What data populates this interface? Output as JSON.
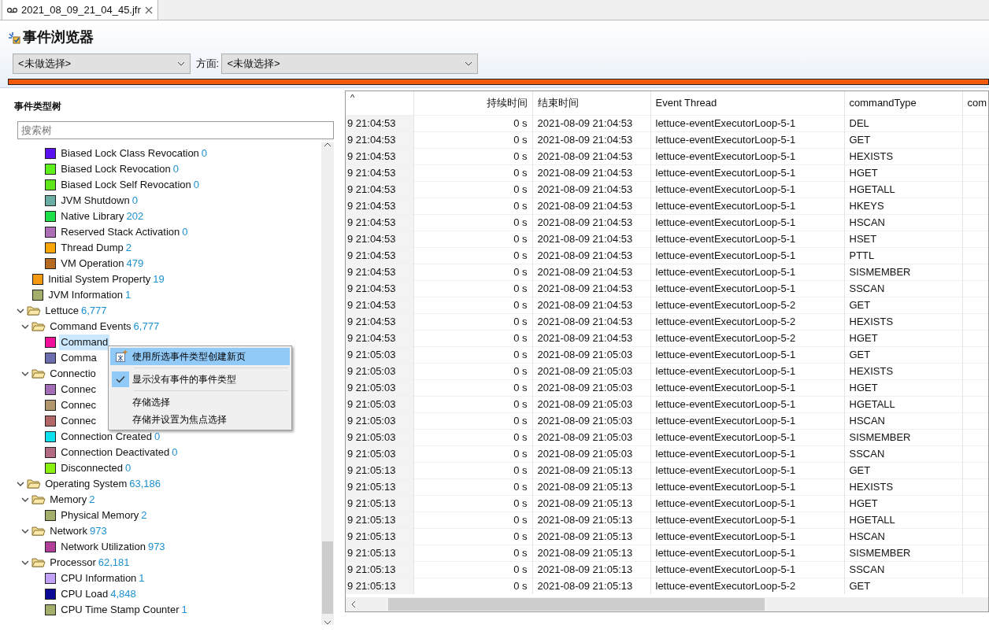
{
  "tab": {
    "title": "2021_08_09_21_04_45.jfr",
    "selected": true
  },
  "page": {
    "title": "事件浏览器",
    "progress": {
      "level": 1
    }
  },
  "filters": {
    "first": {
      "value": "<未做选择>"
    },
    "aspect_label": "方面:",
    "aspect": {
      "value": "<未做选择>"
    }
  },
  "tree": {
    "title": "事件类型树",
    "search": {
      "placeholder": "搜索树"
    },
    "items": [
      {
        "children": [
          {
            "children": [
              {
                "label": "Biased Lock Class Revocation",
                "count": "0",
                "color": "#5b10f0"
              },
              {
                "label": "Biased Lock Revocation",
                "count": "0",
                "color": "#5ef01a"
              },
              {
                "label": "Biased Lock Self Revocation",
                "count": "0",
                "color": "#5ee61a"
              },
              {
                "label": "JVM Shutdown",
                "count": "0",
                "color": "#6aaea6"
              },
              {
                "label": "Native Library",
                "count": "202",
                "color": "#1ee04a"
              },
              {
                "label": "Reserved Stack Activation",
                "count": "0",
                "color": "#ae6eb6"
              },
              {
                "label": "Thread Dump",
                "count": "2",
                "color": "#fca60a"
              },
              {
                "label": "VM Operation",
                "count": "479",
                "color": "#b66a22"
              }
            ]
          },
          {
            "label": "Initial System Property",
            "count": "19",
            "color": "#f49a12"
          },
          {
            "label": "JVM Information",
            "count": "1",
            "color": "#a2ae6a"
          }
        ]
      },
      {
        "label": "Lettuce",
        "count": "6,777",
        "expanded": true,
        "children": [
          {
            "label": "Command Events",
            "count": "6,777",
            "expanded": true,
            "children": [
              {
                "label": "Command",
                "color": "#f0109a",
                "selected": true
              },
              {
                "label": "Comma",
                "color": "#6a6eae"
              }
            ]
          },
          {
            "label": "Connectio",
            "expanded": true,
            "children": [
              {
                "label": "Connec",
                "color": "#a26eb6"
              },
              {
                "label": "Connec",
                "color": "#b2966e"
              },
              {
                "label": "Connec",
                "color": "#b26666"
              },
              {
                "label": "Connection Created",
                "count": "0",
                "color": "#0ee0f0"
              },
              {
                "label": "Connection Deactivated",
                "count": "0",
                "color": "#b26a82"
              },
              {
                "label": "Disconnected",
                "count": "0",
                "color": "#8af00e"
              }
            ]
          }
        ]
      },
      {
        "label": "Operating System",
        "count": "63,186",
        "expanded": true,
        "children": [
          {
            "label": "Memory",
            "count": "2",
            "expanded": true,
            "children": [
              {
                "label": "Physical Memory",
                "count": "2",
                "color": "#a2ae6a"
              }
            ]
          },
          {
            "label": "Network",
            "count": "973",
            "expanded": true,
            "children": [
              {
                "label": "Network Utilization",
                "count": "973",
                "color": "#b2409a"
              }
            ]
          },
          {
            "label": "Processor",
            "count": "62,181",
            "expanded": true,
            "children": [
              {
                "label": "CPU Information",
                "count": "1",
                "color": "#c2a2f8"
              },
              {
                "label": "CPU Load",
                "count": "4,848",
                "color": "#0a0a96"
              },
              {
                "label": "CPU Time Stamp Counter",
                "count": "1",
                "color": "#a2ae6a"
              }
            ]
          }
        ]
      }
    ]
  },
  "context_menu": {
    "items": [
      {
        "kind": "icon-action",
        "label": "使用所选事件类型创建新页",
        "selected": true
      },
      {
        "kind": "separator"
      },
      {
        "kind": "check",
        "label": "显示没有事件的事件类型",
        "checked": true,
        "selected": false
      },
      {
        "kind": "separator"
      },
      {
        "kind": "action",
        "label": "存储选择",
        "selected": false
      },
      {
        "kind": "action",
        "label": "存储并设置为焦点选择",
        "selected": false
      }
    ]
  },
  "table": {
    "columns": [
      {
        "label": "^",
        "kind": "text"
      },
      {
        "label": "持续时间",
        "kind": "number"
      },
      {
        "label": "结束时间",
        "kind": "text"
      },
      {
        "label": "Event Thread",
        "kind": "text"
      },
      {
        "label": "commandType",
        "kind": "text"
      },
      {
        "label": "com",
        "kind": "text"
      }
    ],
    "rows": [
      [
        "9 21:04:53",
        "0 s",
        "2021-08-09 21:04:53",
        "lettuce-eventExecutorLoop-5-1",
        "DEL"
      ],
      [
        "9 21:04:53",
        "0 s",
        "2021-08-09 21:04:53",
        "lettuce-eventExecutorLoop-5-1",
        "GET"
      ],
      [
        "9 21:04:53",
        "0 s",
        "2021-08-09 21:04:53",
        "lettuce-eventExecutorLoop-5-1",
        "HEXISTS"
      ],
      [
        "9 21:04:53",
        "0 s",
        "2021-08-09 21:04:53",
        "lettuce-eventExecutorLoop-5-1",
        "HGET"
      ],
      [
        "9 21:04:53",
        "0 s",
        "2021-08-09 21:04:53",
        "lettuce-eventExecutorLoop-5-1",
        "HGETALL"
      ],
      [
        "9 21:04:53",
        "0 s",
        "2021-08-09 21:04:53",
        "lettuce-eventExecutorLoop-5-1",
        "HKEYS"
      ],
      [
        "9 21:04:53",
        "0 s",
        "2021-08-09 21:04:53",
        "lettuce-eventExecutorLoop-5-1",
        "HSCAN"
      ],
      [
        "9 21:04:53",
        "0 s",
        "2021-08-09 21:04:53",
        "lettuce-eventExecutorLoop-5-1",
        "HSET"
      ],
      [
        "9 21:04:53",
        "0 s",
        "2021-08-09 21:04:53",
        "lettuce-eventExecutorLoop-5-1",
        "PTTL"
      ],
      [
        "9 21:04:53",
        "0 s",
        "2021-08-09 21:04:53",
        "lettuce-eventExecutorLoop-5-1",
        "SISMEMBER"
      ],
      [
        "9 21:04:53",
        "0 s",
        "2021-08-09 21:04:53",
        "lettuce-eventExecutorLoop-5-1",
        "SSCAN"
      ],
      [
        "9 21:04:53",
        "0 s",
        "2021-08-09 21:04:53",
        "lettuce-eventExecutorLoop-5-2",
        "GET"
      ],
      [
        "9 21:04:53",
        "0 s",
        "2021-08-09 21:04:53",
        "lettuce-eventExecutorLoop-5-2",
        "HEXISTS"
      ],
      [
        "9 21:04:53",
        "0 s",
        "2021-08-09 21:04:53",
        "lettuce-eventExecutorLoop-5-2",
        "HGET"
      ],
      [
        "9 21:05:03",
        "0 s",
        "2021-08-09 21:05:03",
        "lettuce-eventExecutorLoop-5-1",
        "GET"
      ],
      [
        "9 21:05:03",
        "0 s",
        "2021-08-09 21:05:03",
        "lettuce-eventExecutorLoop-5-1",
        "HEXISTS"
      ],
      [
        "9 21:05:03",
        "0 s",
        "2021-08-09 21:05:03",
        "lettuce-eventExecutorLoop-5-1",
        "HGET"
      ],
      [
        "9 21:05:03",
        "0 s",
        "2021-08-09 21:05:03",
        "lettuce-eventExecutorLoop-5-1",
        "HGETALL"
      ],
      [
        "9 21:05:03",
        "0 s",
        "2021-08-09 21:05:03",
        "lettuce-eventExecutorLoop-5-1",
        "HSCAN"
      ],
      [
        "9 21:05:03",
        "0 s",
        "2021-08-09 21:05:03",
        "lettuce-eventExecutorLoop-5-1",
        "SISMEMBER"
      ],
      [
        "9 21:05:03",
        "0 s",
        "2021-08-09 21:05:03",
        "lettuce-eventExecutorLoop-5-1",
        "SSCAN"
      ],
      [
        "9 21:05:13",
        "0 s",
        "2021-08-09 21:05:13",
        "lettuce-eventExecutorLoop-5-1",
        "GET"
      ],
      [
        "9 21:05:13",
        "0 s",
        "2021-08-09 21:05:13",
        "lettuce-eventExecutorLoop-5-1",
        "HEXISTS"
      ],
      [
        "9 21:05:13",
        "0 s",
        "2021-08-09 21:05:13",
        "lettuce-eventExecutorLoop-5-1",
        "HGET"
      ],
      [
        "9 21:05:13",
        "0 s",
        "2021-08-09 21:05:13",
        "lettuce-eventExecutorLoop-5-1",
        "HGETALL"
      ],
      [
        "9 21:05:13",
        "0 s",
        "2021-08-09 21:05:13",
        "lettuce-eventExecutorLoop-5-1",
        "HSCAN"
      ],
      [
        "9 21:05:13",
        "0 s",
        "2021-08-09 21:05:13",
        "lettuce-eventExecutorLoop-5-1",
        "SISMEMBER"
      ],
      [
        "9 21:05:13",
        "0 s",
        "2021-08-09 21:05:13",
        "lettuce-eventExecutorLoop-5-1",
        "SSCAN"
      ],
      [
        "9 21:05:13",
        "0 s",
        "2021-08-09 21:05:13",
        "lettuce-eventExecutorLoop-5-2",
        "GET"
      ]
    ]
  }
}
